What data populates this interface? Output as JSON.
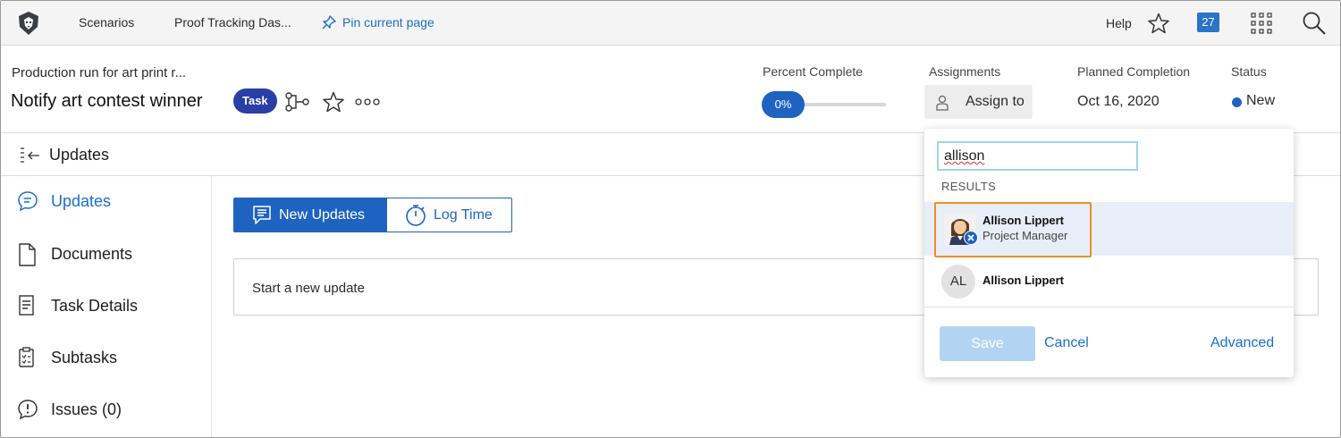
{
  "topnav": {
    "links": [
      "Scenarios",
      "Proof Tracking Das..."
    ],
    "pin_label": "Pin current page",
    "help_label": "Help",
    "badge_count": "27"
  },
  "header": {
    "parent_name": "Production run for art print r...",
    "title": "Notify art contest winner",
    "type_badge": "Task",
    "percent_label": "Percent Complete",
    "percent_value": "0%",
    "percent_fraction": 0,
    "assignments_label": "Assignments",
    "assign_button": "Assign to",
    "planned_label": "Planned Completion",
    "planned_value": "Oct 16, 2020",
    "status_label": "Status",
    "status_value": "New",
    "status_color": "#1f63c1"
  },
  "updates_bar": {
    "title": "Updates"
  },
  "sidebar": {
    "items": [
      {
        "label": "Updates",
        "icon": "chat-bubble-icon",
        "active": true
      },
      {
        "label": "Documents",
        "icon": "document-icon",
        "active": false
      },
      {
        "label": "Task Details",
        "icon": "details-icon",
        "active": false
      },
      {
        "label": "Subtasks",
        "icon": "clipboard-list-icon",
        "active": false
      },
      {
        "label": "Issues (0)",
        "icon": "issue-icon",
        "active": false
      }
    ]
  },
  "main": {
    "tabs": [
      {
        "label": "New Updates",
        "icon": "updates-doc-icon",
        "selected": true
      },
      {
        "label": "Log Time",
        "icon": "stopwatch-icon",
        "selected": false
      }
    ],
    "new_update_placeholder": "Start a new update"
  },
  "assign_dropdown": {
    "search_value": "allison",
    "results_label": "RESULTS",
    "results": [
      {
        "name": "Allison Lippert",
        "role": "Project Manager",
        "avatar": "photo",
        "highlighted": true
      },
      {
        "name": "Allison Lippert",
        "initials": "AL",
        "avatar": "initials"
      }
    ],
    "save_label": "Save",
    "cancel_label": "Cancel",
    "advanced_label": "Advanced"
  },
  "colors": {
    "accent": "#1f63c1",
    "link": "#1a6fc7",
    "highlight_border": "#ef8d25",
    "badge_bg": "#2a3fa5"
  }
}
